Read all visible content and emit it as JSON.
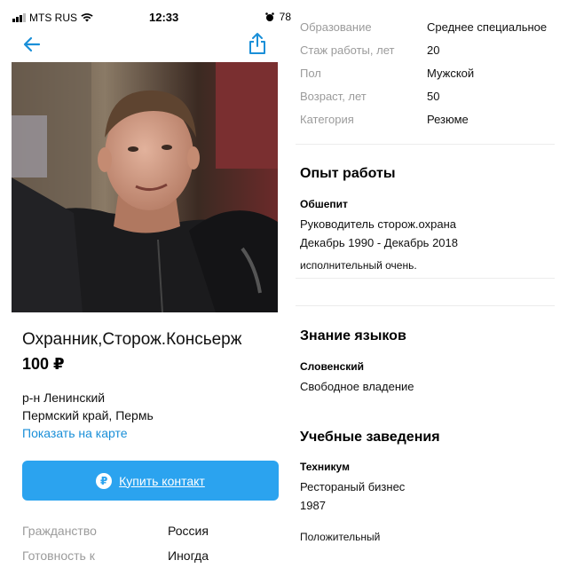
{
  "status_bar": {
    "carrier": "MTS RUS",
    "time": "12:33",
    "battery": "78"
  },
  "listing": {
    "title": "Охранник,Сторож.Консьерж",
    "price": "100 ₽",
    "location_line1": "р-н Ленинский",
    "location_line2": "Пермский край, Пермь",
    "map_link": "Показать на карте",
    "buy_button": "Купить контакт",
    "buy_icon": "₽",
    "details": [
      {
        "label": "Гражданство",
        "value": "Россия"
      },
      {
        "label": "Готовность к",
        "value": "Иногда"
      }
    ]
  },
  "right": {
    "details": [
      {
        "label": "Образование",
        "value": "Среднее специальное"
      },
      {
        "label": "Стаж работы, лет",
        "value": "20"
      },
      {
        "label": "Пол",
        "value": "Мужской"
      },
      {
        "label": "Возраст, лет",
        "value": "50"
      },
      {
        "label": "Категория",
        "value": "Резюме"
      }
    ],
    "experience": {
      "title": "Опыт работы",
      "company": "Обшепит",
      "position": "Руководитель сторож.охрана",
      "period": "Декабрь 1990 - Декабрь 2018",
      "description": "исполнительный очень."
    },
    "languages": {
      "title": "Знание языков",
      "language": "Словенский",
      "level": "Свободное владение"
    },
    "education": {
      "title": "Учебные заведения",
      "institution": "Техникум",
      "specialty": "Ресторaный бизнес",
      "year": "1987",
      "extra": "Положительный"
    }
  },
  "colors": {
    "accent": "#2ba3ef",
    "link": "#1a8fd8",
    "muted": "#9b9b9b"
  }
}
